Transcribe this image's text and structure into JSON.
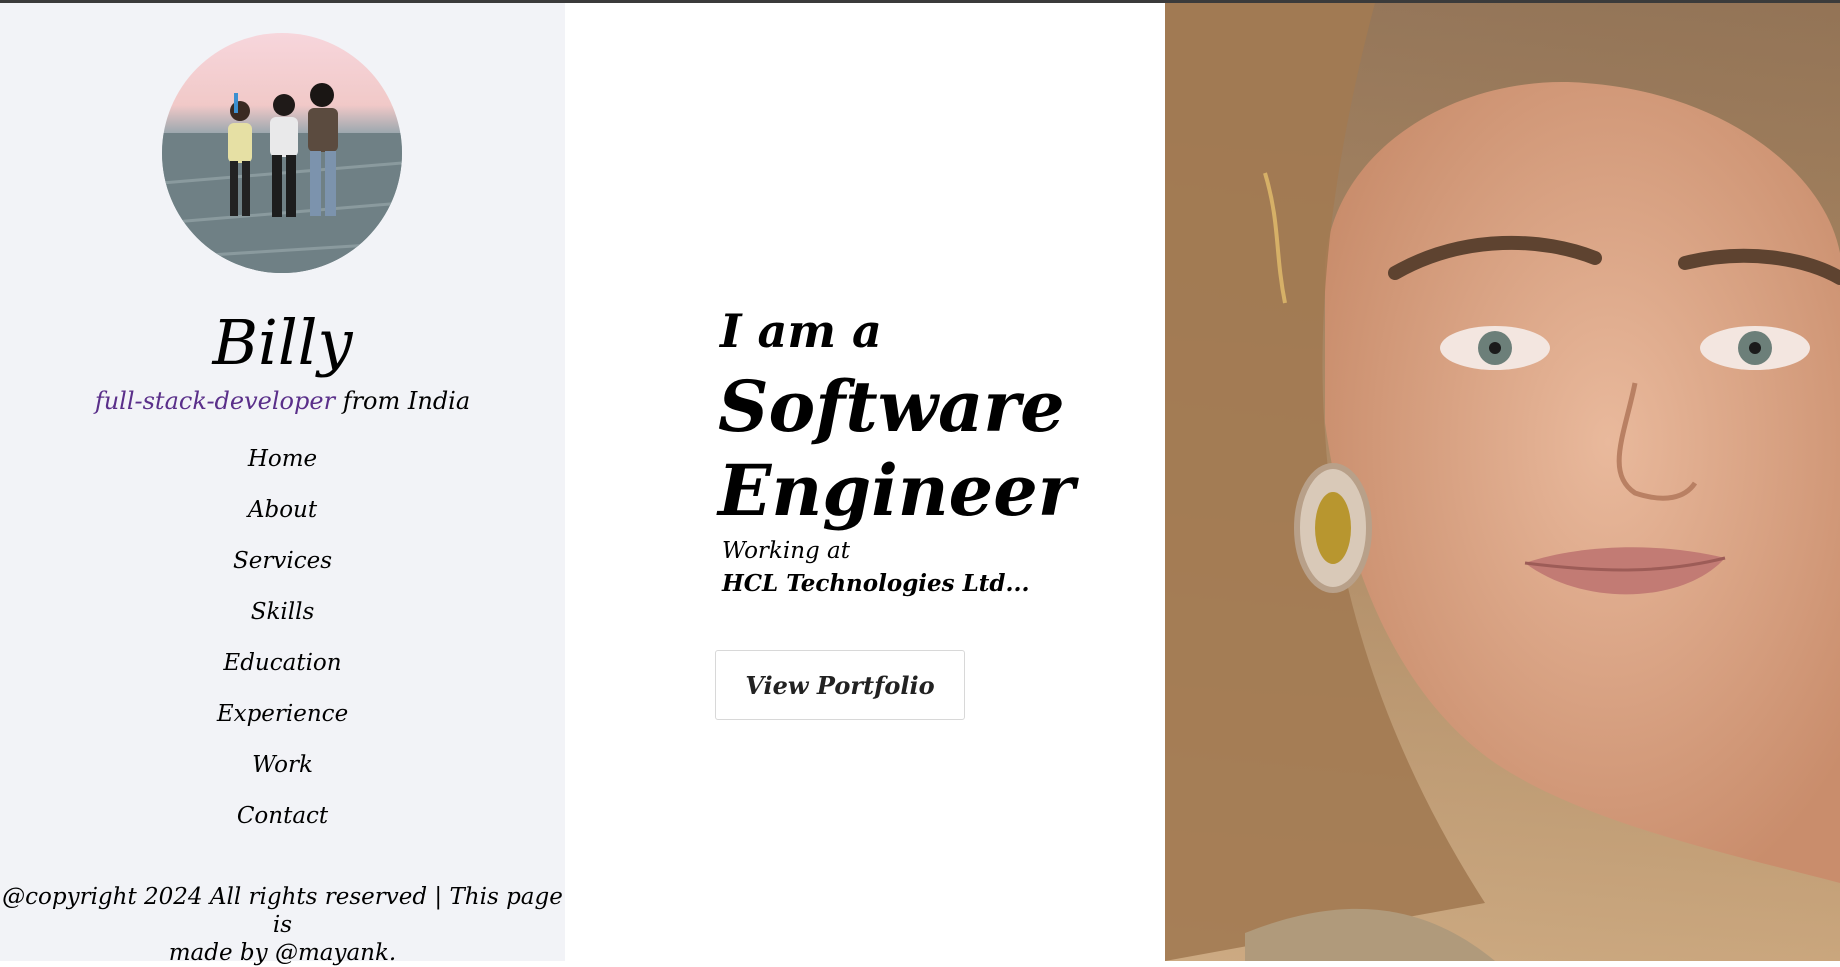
{
  "profile": {
    "name": "Billy",
    "role": "full-stack-developer",
    "location": "from India",
    "avatar": "group-photo-avatar"
  },
  "nav": {
    "items": [
      {
        "label": "Home"
      },
      {
        "label": "About"
      },
      {
        "label": "Services"
      },
      {
        "label": "Skills"
      },
      {
        "label": "Education"
      },
      {
        "label": "Experience"
      },
      {
        "label": "Work"
      },
      {
        "label": "Contact"
      }
    ]
  },
  "footer": {
    "copyright_line1": "@copyright 2024 All rights reserved | This page is",
    "copyright_line2": "made by @mayank."
  },
  "hero": {
    "intro": "I am a",
    "title_line1": "Software",
    "title_line2": "Engineer",
    "working_at": "Working at",
    "company": "HCL Technologies Ltd...",
    "cta_label": "View Portfolio",
    "photo": "portrait-photo"
  },
  "colors": {
    "sidebar_bg": "#f2f3f7",
    "role_accent": "#5a2f8a",
    "text": "#000000"
  }
}
